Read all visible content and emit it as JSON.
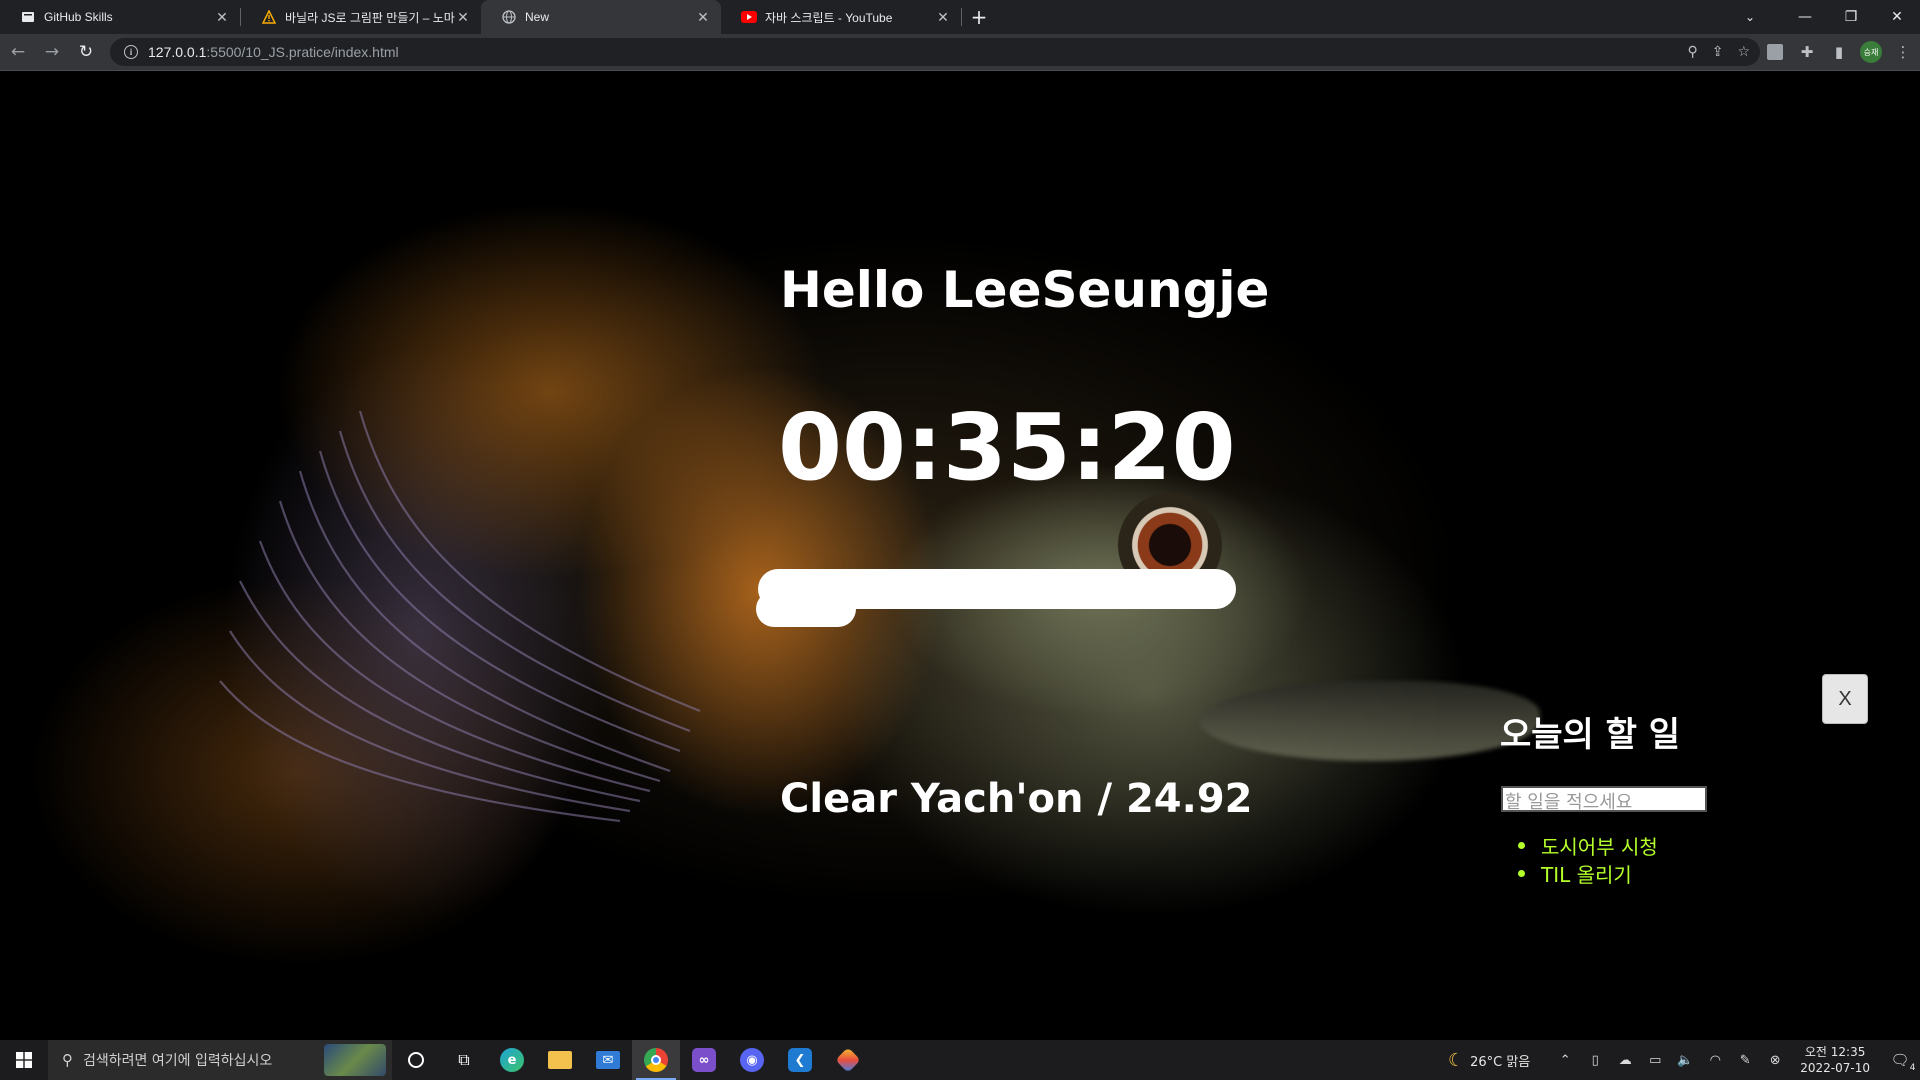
{
  "browser": {
    "tabs": [
      {
        "title": "GitHub Skills",
        "icon": "github-icon"
      },
      {
        "title": "바닐라 JS로 그림판 만들기 – 노마드",
        "icon": "warning-icon"
      },
      {
        "title": "New",
        "icon": "globe-icon"
      },
      {
        "title": "자바 스크립트 - YouTube",
        "icon": "youtube-icon"
      }
    ],
    "active_tab_index": 2,
    "url_host": "127.0.0.1",
    "url_path": ":5500/10_JS.pratice/index.html",
    "profile_initials": "승재"
  },
  "page": {
    "greeting": "Hello LeeSeungje",
    "clock": "00:35:20",
    "quote": "Clear Yach'on / 24.92",
    "close_label": "X",
    "todo": {
      "title": "오늘의 할 일",
      "placeholder": "할 일을 적으세요",
      "items": [
        "도시어부 시청",
        "TIL 올리기"
      ],
      "item_color": "#b5ff2a"
    }
  },
  "taskbar": {
    "search_placeholder": "검색하려면 여기에 입력하십시오",
    "apps": [
      "cortana",
      "task-view",
      "edge",
      "file-explorer",
      "mail",
      "chrome",
      "visual-studio",
      "discord",
      "vscode",
      "git-kraken"
    ],
    "weather": "26°C  맑음",
    "time": "오전 12:35",
    "date": "2022-07-10",
    "notification_count": "4"
  }
}
